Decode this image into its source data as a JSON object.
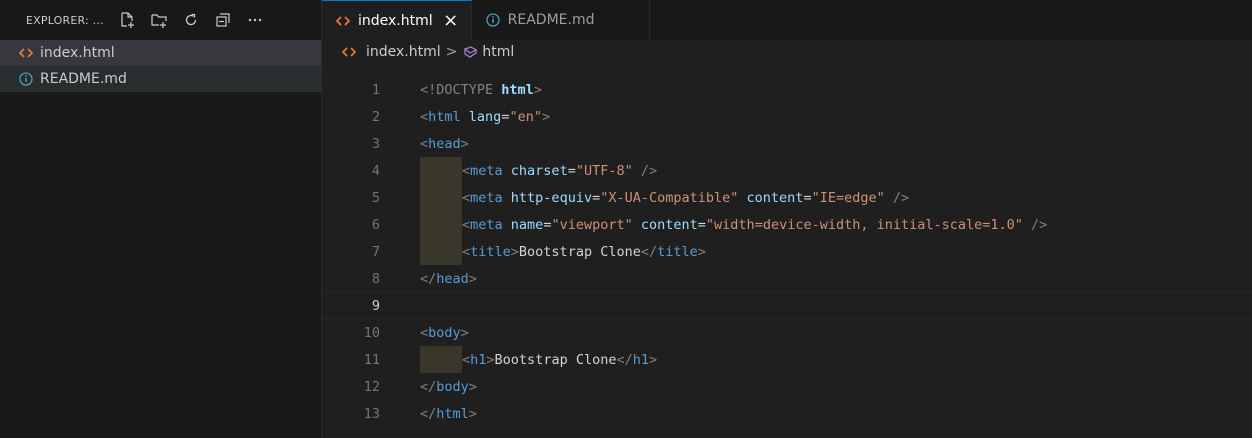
{
  "colors": {
    "accent": "#0078d4",
    "html_icon": "#e37933",
    "info_icon": "#519aba"
  },
  "sidebar": {
    "title": "EXPLORER: ...",
    "actions": [
      "new-file-icon",
      "new-folder-icon",
      "refresh-icon",
      "collapse-all-icon",
      "more-icon"
    ],
    "files": [
      {
        "name": "index.html",
        "icon": "html-file-icon"
      },
      {
        "name": "README.md",
        "icon": "info-icon"
      }
    ]
  },
  "tabs": [
    {
      "label": "index.html",
      "icon": "html-file-icon",
      "active": true,
      "close": "×"
    },
    {
      "label": "README.md",
      "icon": "info-icon",
      "active": false
    }
  ],
  "breadcrumb": {
    "file": "index.html",
    "separator": ">",
    "symbol": "html"
  },
  "editor": {
    "current_line": 9,
    "lines": [
      {
        "n": "1"
      },
      {
        "n": "2"
      },
      {
        "n": "3"
      },
      {
        "n": "4"
      },
      {
        "n": "5"
      },
      {
        "n": "6"
      },
      {
        "n": "7"
      },
      {
        "n": "8"
      },
      {
        "n": "9"
      },
      {
        "n": "10"
      },
      {
        "n": "11"
      },
      {
        "n": "12"
      },
      {
        "n": "13"
      }
    ],
    "tokens": {
      "l1": [
        "<!DOCTYPE",
        " ",
        "html",
        ">"
      ],
      "l2": [
        "<",
        "html",
        " ",
        "lang",
        "=",
        "\"en\"",
        ">"
      ],
      "l3": [
        "<",
        "head",
        ">"
      ],
      "l4": [
        "<",
        "meta",
        " ",
        "charset",
        "=",
        "\"UTF-8\"",
        " />"
      ],
      "l5": [
        "<",
        "meta",
        " ",
        "http-equiv",
        "=",
        "\"X-UA-Compatible\"",
        " ",
        "content",
        "=",
        "\"IE=edge\"",
        " />"
      ],
      "l6": [
        "<",
        "meta",
        " ",
        "name",
        "=",
        "\"viewport\"",
        " ",
        "content",
        "=",
        "\"width=device-width, initial-scale=1.0\"",
        " />"
      ],
      "l7": [
        "<",
        "title",
        ">",
        "Bootstrap Clone",
        "</",
        "title",
        ">"
      ],
      "l8": [
        "</",
        "head",
        ">"
      ],
      "l10": [
        "<",
        "body",
        ">"
      ],
      "l11": [
        "<",
        "h1",
        ">",
        "Bootstrap Clone",
        "</",
        "h1",
        ">"
      ],
      "l12": [
        "</",
        "body",
        ">"
      ],
      "l13": [
        "</",
        "html",
        ">"
      ]
    }
  }
}
